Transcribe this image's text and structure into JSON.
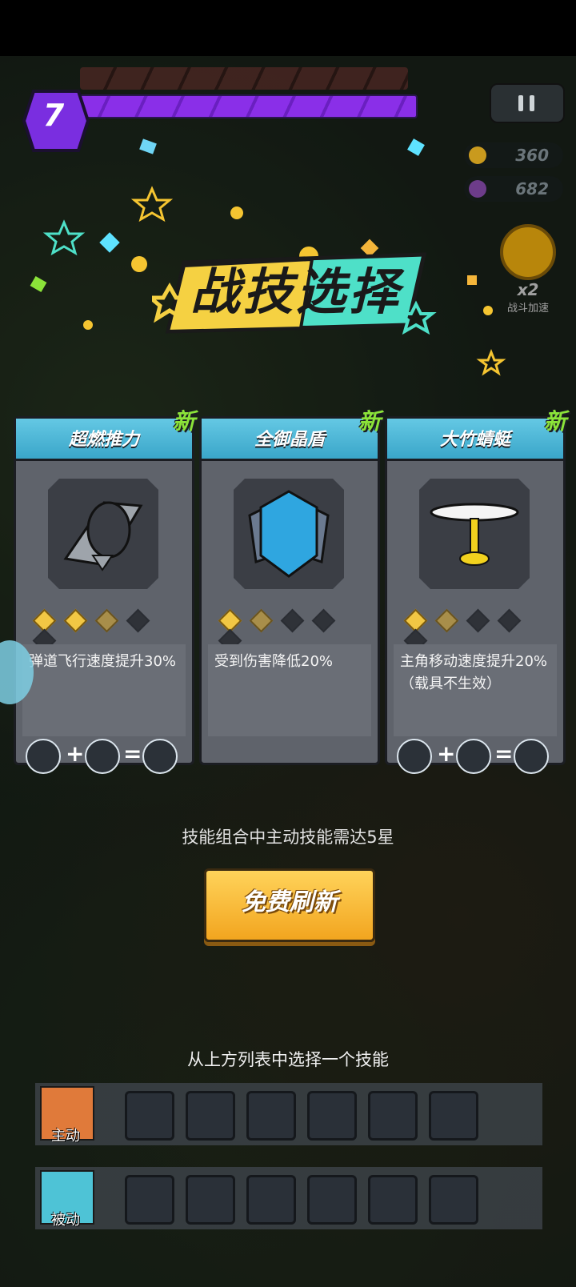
{
  "level": "7",
  "resources": {
    "coins": "360",
    "gems": "682"
  },
  "speed": {
    "multiplier": "x2",
    "label": "战斗加速"
  },
  "title": "战技选择",
  "cards": [
    {
      "name": "超燃推力",
      "new_tag": "新",
      "desc": "弹道飞行速度提升30%",
      "stars": 5,
      "filled": 2,
      "half": 1
    },
    {
      "name": "全御晶盾",
      "new_tag": "新",
      "desc": "受到伤害降低20%",
      "stars": 5,
      "filled": 1,
      "half": 1
    },
    {
      "name": "大竹蜻蜓",
      "new_tag": "新",
      "desc": "主角移动速度提升20%（载具不生效）",
      "stars": 5,
      "filled": 1,
      "half": 1
    }
  ],
  "combo_ops": {
    "plus": "+",
    "equals": "="
  },
  "requirement_hint": "技能组合中主动技能需达5星",
  "refresh_button": "免费刷新",
  "choose_hint": "从上方列表中选择一个技能",
  "slots": {
    "active_label": "主动",
    "passive_label": "被动",
    "active_color": "#e07a3a",
    "passive_color": "#4ec3d6"
  },
  "colors": {
    "xp": "#8a2fe8",
    "card_header": "#3aa6c9",
    "new_tag": "#8be339",
    "button": "#f2a51f"
  }
}
